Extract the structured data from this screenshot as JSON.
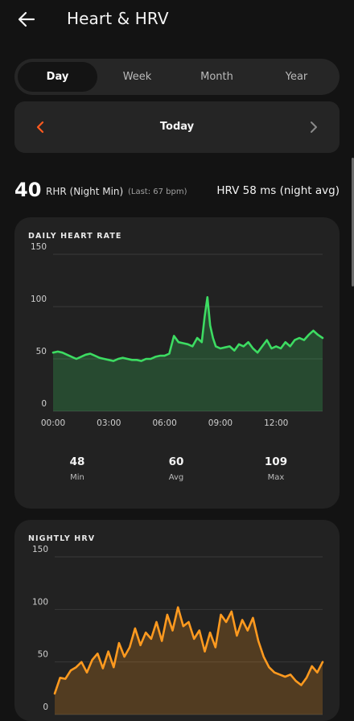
{
  "header": {
    "title": "Heart & HRV",
    "back_icon": "arrow-left-icon"
  },
  "tabs": [
    {
      "label": "Day",
      "active": true
    },
    {
      "label": "Week",
      "active": false
    },
    {
      "label": "Month",
      "active": false
    },
    {
      "label": "Year",
      "active": false
    }
  ],
  "date_nav": {
    "label": "Today",
    "prev_icon": "chevron-left-icon",
    "next_icon": "chevron-right-icon"
  },
  "stats": {
    "rhr_value": "40",
    "rhr_label": "RHR (Night Min)",
    "rhr_last": "(Last: 67 bpm)",
    "hrv_summary": "HRV 58 ms (night avg)"
  },
  "colors": {
    "background": "#131313",
    "card": "#222222",
    "heart_line": "#3ddc62",
    "hrv_line": "#ff9a1f",
    "prev_arrow": "#ff5a1f"
  },
  "daily_heart_rate": {
    "title": "DAILY HEART RATE",
    "summary": [
      {
        "value": "48",
        "label": "Min"
      },
      {
        "value": "60",
        "label": "Avg"
      },
      {
        "value": "109",
        "label": "Max"
      }
    ],
    "chart_data": {
      "type": "area",
      "ylim": [
        0,
        150
      ],
      "yticks": [
        "0",
        "50",
        "100",
        "150"
      ],
      "xlim": [
        0,
        14.5
      ],
      "xticks": [
        {
          "value": 0,
          "label": "00:00"
        },
        {
          "value": 3,
          "label": "03:00"
        },
        {
          "value": 6,
          "label": "06:00"
        },
        {
          "value": 9,
          "label": "09:00"
        },
        {
          "value": 12,
          "label": "12:00"
        }
      ],
      "x": [
        0,
        0.25,
        0.5,
        0.75,
        1.0,
        1.25,
        1.5,
        1.75,
        2.0,
        2.25,
        2.5,
        2.75,
        3.0,
        3.25,
        3.5,
        3.75,
        4.0,
        4.25,
        4.5,
        4.75,
        5.0,
        5.25,
        5.5,
        5.75,
        6.0,
        6.25,
        6.5,
        6.75,
        7.0,
        7.25,
        7.5,
        7.75,
        8.0,
        8.15,
        8.3,
        8.45,
        8.6,
        8.75,
        9.0,
        9.25,
        9.5,
        9.75,
        10.0,
        10.25,
        10.5,
        10.75,
        11.0,
        11.25,
        11.5,
        11.75,
        12.0,
        12.25,
        12.5,
        12.75,
        13.0,
        13.25,
        13.5,
        13.75,
        14.0,
        14.25,
        14.5
      ],
      "values": [
        56,
        57,
        56,
        54,
        52,
        50,
        52,
        54,
        55,
        53,
        51,
        50,
        49,
        48,
        50,
        51,
        50,
        49,
        49,
        48,
        50,
        50,
        52,
        53,
        53,
        55,
        72,
        66,
        65,
        64,
        62,
        70,
        66,
        90,
        109,
        82,
        70,
        62,
        60,
        61,
        62,
        58,
        64,
        62,
        66,
        60,
        56,
        62,
        68,
        60,
        62,
        60,
        66,
        62,
        68,
        70,
        68,
        73,
        77,
        73,
        70
      ]
    }
  },
  "nightly_hrv": {
    "title": "NIGHTLY HRV",
    "chart_data": {
      "type": "area",
      "ylim": [
        0,
        150
      ],
      "yticks": [
        "0",
        "50",
        "100",
        "150"
      ],
      "xlim": [
        0,
        1
      ],
      "x": [
        0,
        0.02,
        0.04,
        0.06,
        0.08,
        0.1,
        0.12,
        0.14,
        0.16,
        0.18,
        0.2,
        0.22,
        0.24,
        0.26,
        0.28,
        0.3,
        0.32,
        0.34,
        0.36,
        0.38,
        0.4,
        0.42,
        0.44,
        0.46,
        0.48,
        0.5,
        0.52,
        0.54,
        0.56,
        0.58,
        0.6,
        0.62,
        0.64,
        0.66,
        0.68,
        0.7,
        0.72,
        0.74,
        0.76,
        0.78,
        0.8,
        0.82,
        0.84,
        0.86,
        0.88,
        0.9,
        0.92,
        0.94,
        0.96,
        0.98,
        1.0
      ],
      "values": [
        20,
        35,
        34,
        42,
        45,
        50,
        40,
        52,
        58,
        44,
        60,
        45,
        68,
        55,
        64,
        82,
        66,
        78,
        72,
        88,
        70,
        95,
        80,
        102,
        84,
        88,
        72,
        80,
        60,
        78,
        64,
        95,
        88,
        98,
        75,
        90,
        80,
        92,
        70,
        55,
        45,
        40,
        38,
        36,
        38,
        32,
        28,
        35,
        46,
        40,
        50
      ]
    }
  }
}
